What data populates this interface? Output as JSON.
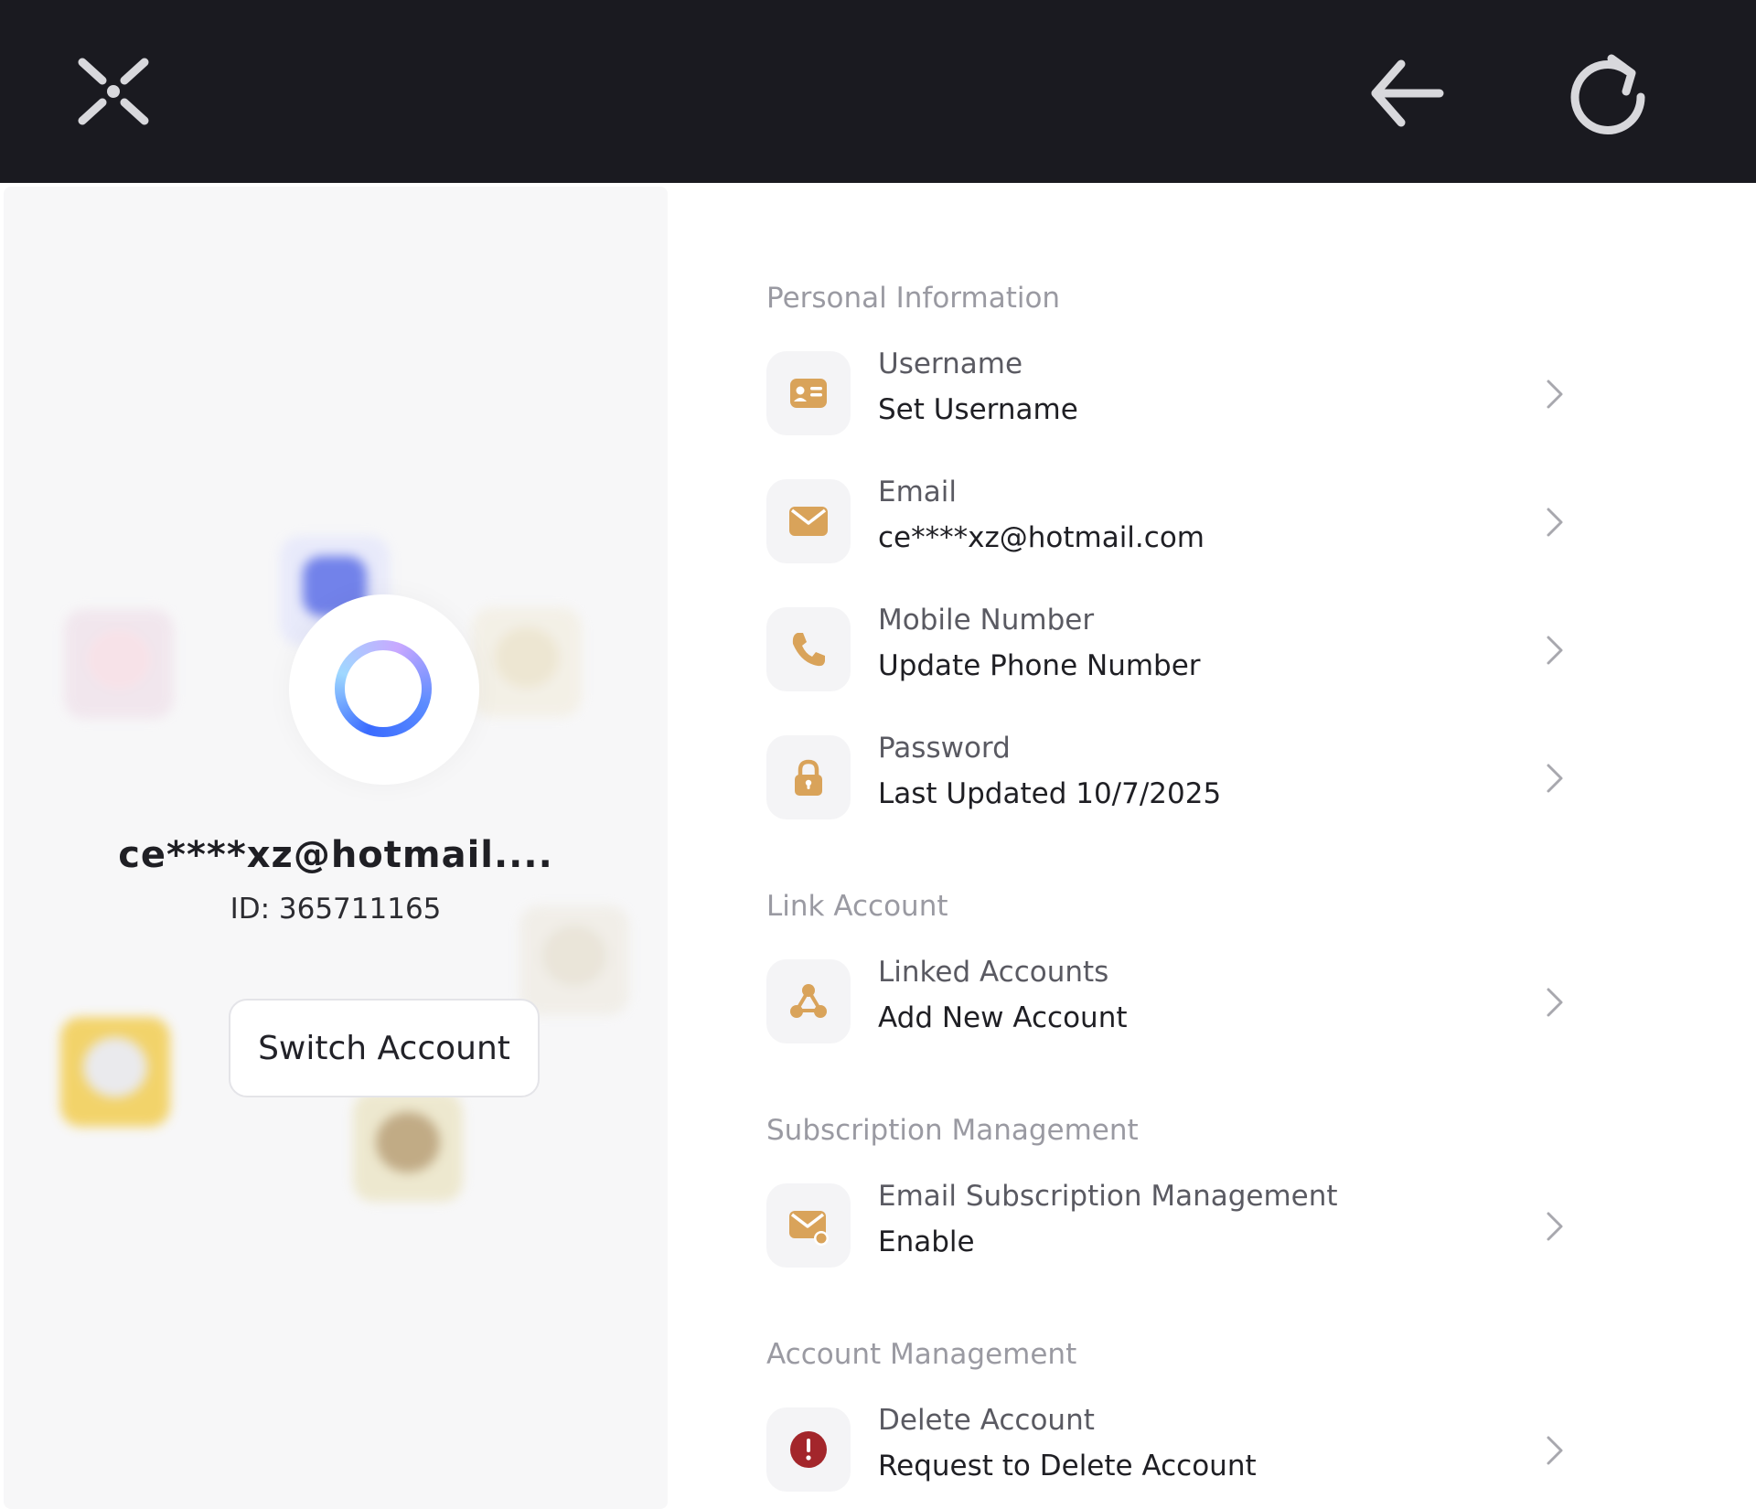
{
  "topbar": {
    "close_icon": "x-cross-icon",
    "back_icon": "arrow-left-icon",
    "refresh_icon": "refresh-icon"
  },
  "profile": {
    "email": "ce****xz@hotmail....",
    "id": "ID: 365711165",
    "switch_label": "Switch Account"
  },
  "sections": {
    "personal": {
      "title": "Personal Information",
      "username": {
        "label": "Username",
        "value": "Set Username"
      },
      "email": {
        "label": "Email",
        "value": "ce****xz@hotmail.com"
      },
      "mobile": {
        "label": "Mobile Number",
        "value": "Update Phone Number"
      },
      "password": {
        "label": "Password",
        "value": "Last Updated 10/7/2025"
      }
    },
    "link": {
      "title": "Link Account",
      "linked": {
        "label": "Linked Accounts",
        "value": "Add New Account"
      }
    },
    "subscription": {
      "title": "Subscription Management",
      "email_sub": {
        "label": "Email Subscription Management",
        "value": "Enable"
      }
    },
    "account": {
      "title": "Account Management",
      "delete": {
        "label": "Delete Account",
        "value": "Request to Delete Account"
      }
    }
  },
  "colors": {
    "topbar": "#1a1a20",
    "accent_gold": "#d9a35a",
    "danger": "#a3262b",
    "muted_text": "#9a9aa2"
  }
}
